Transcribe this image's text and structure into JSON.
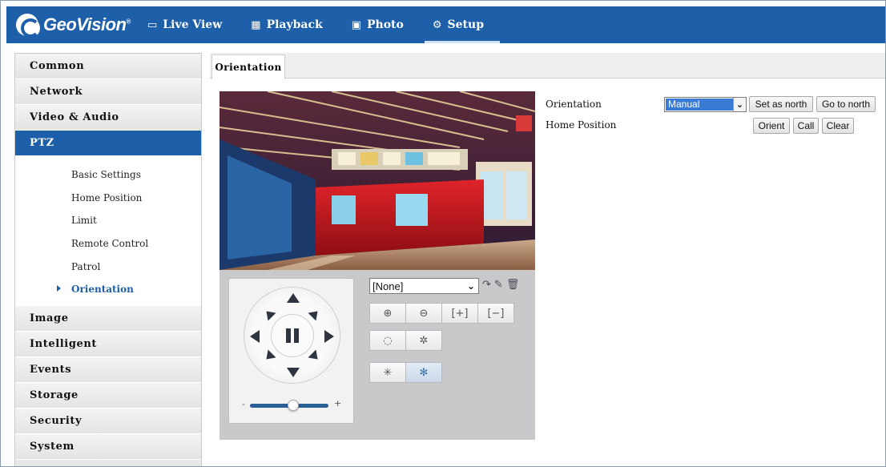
{
  "brand": {
    "name": "GeoVision",
    "mark": "®",
    "color": "#1d5fa8"
  },
  "nav": [
    {
      "label": "Live View",
      "icon": "monitor-icon",
      "glyph": "▭"
    },
    {
      "label": "Playback",
      "icon": "film-icon",
      "glyph": "▦"
    },
    {
      "label": "Photo",
      "icon": "photo-icon",
      "glyph": "▣"
    },
    {
      "label": "Setup",
      "icon": "gear-icon",
      "glyph": "⚙",
      "active": true
    }
  ],
  "sidebar": {
    "common": "Common",
    "network": "Network",
    "video_audio": "Video & Audio",
    "ptz": "PTZ",
    "ptz_sub": {
      "basic": "Basic Settings",
      "home": "Home Position",
      "limit": "Limit",
      "remote": "Remote Control",
      "patrol": "Patrol",
      "orientation": "Orientation"
    },
    "image": "Image",
    "intelligent": "Intelligent",
    "events": "Events",
    "storage": "Storage",
    "security": "Security",
    "system": "System"
  },
  "tab": {
    "label": "Orientation"
  },
  "ptz": {
    "preset_value": "[None]",
    "preset_icons": {
      "goto": "↷",
      "edit": "✎",
      "delete": "🗑"
    },
    "zoom_in": "⊕",
    "zoom_out": "⊖",
    "focus_near": "[+]",
    "focus_far": "[−]",
    "iris_open": "◌",
    "iris_close": "✲",
    "light": "✳",
    "wiper": "✻",
    "speed_minus": "-",
    "speed_plus": "+",
    "speed_level": 0.55
  },
  "form": {
    "orientation_label": "Orientation",
    "orientation_value": "Manual",
    "set_north": "Set as north",
    "go_north": "Go to north",
    "home_label": "Home Position",
    "orient": "Orient",
    "call": "Call",
    "clear": "Clear"
  }
}
